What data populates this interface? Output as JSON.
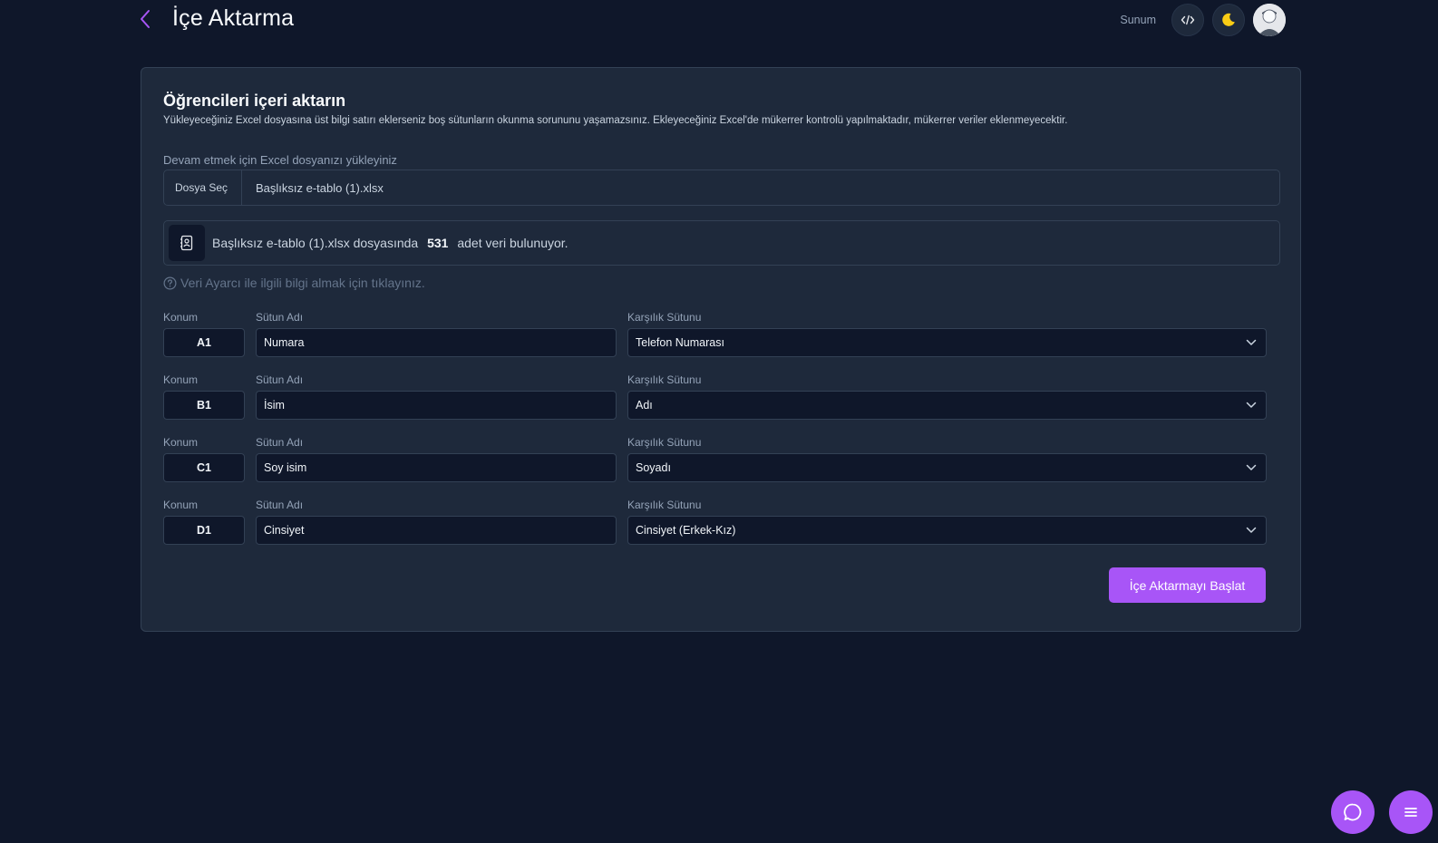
{
  "header": {
    "title": "İçe Aktarma",
    "presentation_label": "Sunum",
    "icons": {
      "back": "chevron-left-icon",
      "code": "code-icon",
      "theme": "moon-icon",
      "avatar": "user-avatar"
    }
  },
  "card": {
    "title": "Öğrencileri içeri aktarın",
    "description": "Yükleyeceğiniz Excel dosyasına üst bilgi satırı eklerseniz boş sütunların okunma sorununu yaşamazsınız. Ekleyeceğiniz Excel'de mükerrer kontrolü yapılmaktadır, mükerrer veriler eklenmeyecektir.",
    "upload": {
      "label": "Devam etmek için Excel dosyanızı yükleyiniz",
      "button": "Dosya Seç",
      "file_name": "Başlıksız e-tablo (1).xlsx"
    },
    "info": {
      "prefix": "Başlıksız e-tablo (1).xlsx dosyasında",
      "count": "531",
      "suffix": "adet veri bulunuyor."
    },
    "help_text": "Veri Ayarcı ile ilgili bilgi almak için tıklayınız.",
    "labels": {
      "konum": "Konum",
      "sutun": "Sütun Adı",
      "karsilik": "Karşılık Sütunu"
    },
    "rows": [
      {
        "position": "A1",
        "column_name": "Numara",
        "mapping": "Telefon Numarası"
      },
      {
        "position": "B1",
        "column_name": "İsim",
        "mapping": "Adı"
      },
      {
        "position": "C1",
        "column_name": "Soy isim",
        "mapping": "Soyadı"
      },
      {
        "position": "D1",
        "column_name": "Cinsiyet",
        "mapping": "Cinsiyet (Erkek-Kız)"
      }
    ],
    "start_button": "İçe Aktarmayı Başlat"
  },
  "colors": {
    "accent": "#a855f7",
    "background": "#0f172a",
    "card": "#1e293b",
    "moon": "#facc15"
  }
}
